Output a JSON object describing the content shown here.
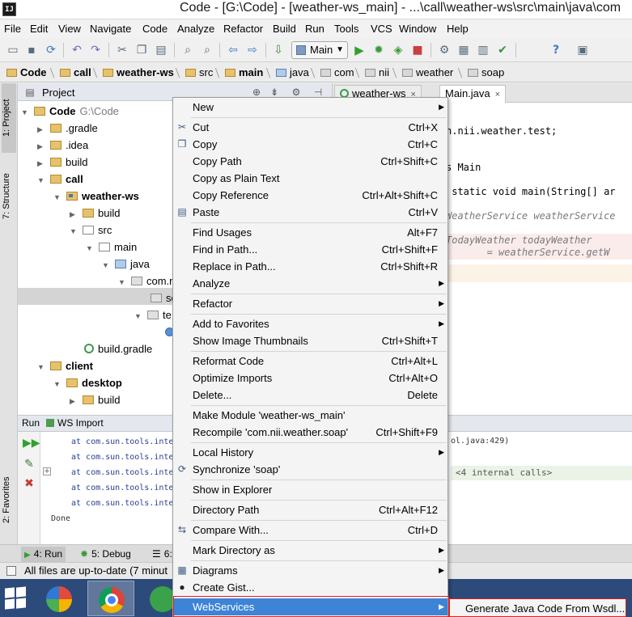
{
  "window": {
    "app_icon": "IJ",
    "title": "Code - [G:\\Code] - [weather-ws_main] - ...\\call\\weather-ws\\src\\main\\java\\com"
  },
  "menubar": {
    "items": [
      "File",
      "Edit",
      "View",
      "Navigate",
      "Code",
      "Analyze",
      "Refactor",
      "Build",
      "Run",
      "Tools",
      "VCS",
      "Window",
      "Help"
    ]
  },
  "toolbar": {
    "run_config": "Main",
    "icons": [
      "save-icon",
      "sync-icon",
      "undo-icon",
      "redo-icon",
      "cut-icon",
      "copy-icon",
      "paste-icon",
      "find-icon",
      "replace-icon",
      "back-icon",
      "forward-icon",
      "build-icon",
      "run-icon",
      "debug-icon",
      "coverage-icon",
      "stop-icon",
      "settings-icon",
      "project-structure-icon",
      "help-icon",
      "terminal-icon"
    ]
  },
  "breadcrumbs": [
    "Code",
    "call",
    "weather-ws",
    "src",
    "main",
    "java",
    "com",
    "nii",
    "weather",
    "soap"
  ],
  "left_strip": {
    "project": "1: Project",
    "structure": "7: Structure",
    "favorites": "2: Favorites"
  },
  "project_panel": {
    "title": "Project",
    "tree": [
      {
        "label": "Code",
        "note": "G:\\Code",
        "bold": true
      },
      {
        "label": ".gradle"
      },
      {
        "label": ".idea"
      },
      {
        "label": "build"
      },
      {
        "label": "call",
        "bold": true
      },
      {
        "label": "weather-ws",
        "bold": true
      },
      {
        "label": "build"
      },
      {
        "label": "src"
      },
      {
        "label": "main"
      },
      {
        "label": "java"
      },
      {
        "label": "com.n"
      },
      {
        "label": "so"
      },
      {
        "label": "te"
      },
      {
        "label": ""
      },
      {
        "label": "build.gradle"
      },
      {
        "label": "client",
        "bold": true
      },
      {
        "label": "desktop",
        "bold": true
      },
      {
        "label": "build"
      }
    ]
  },
  "editor": {
    "tabs": [
      {
        "label": "weather-ws",
        "close": "×"
      },
      {
        "label": "Main.java",
        "close": "×"
      }
    ],
    "lines": [
      "n.nii.weather.test;",
      "",
      "s Main",
      "",
      " static void main(String[] ar",
      "",
      "WeatherService weatherService",
      "",
      "TodayWeather todayWeather",
      "       = weatherService.getW"
    ]
  },
  "run_panel": {
    "title": "Run",
    "tab": "WS Import",
    "log": [
      "at com.sun.tools.inte",
      "at com.sun.tools.inte",
      "at com.sun.tools.inte",
      "at com.sun.tools.inte",
      "at com.sun.tools.inte",
      "Done"
    ],
    "link_text": "ol.java:429)",
    "internal_calls": "<4 internal calls>"
  },
  "bottom_tabs": [
    "4: Run",
    "5: Debug",
    "6:"
  ],
  "status": {
    "text": "All files are up-to-date (7 minut"
  },
  "context_menu": {
    "items": [
      {
        "label": "New",
        "submenu": "▶"
      },
      {
        "sep": true
      },
      {
        "label": "Cut",
        "shortcut": "Ctrl+X",
        "icon": "✂"
      },
      {
        "label": "Copy",
        "shortcut": "Ctrl+C",
        "icon": "❐"
      },
      {
        "label": "Copy Path",
        "shortcut": "Ctrl+Shift+C"
      },
      {
        "label": "Copy as Plain Text"
      },
      {
        "label": "Copy Reference",
        "shortcut": "Ctrl+Alt+Shift+C"
      },
      {
        "label": "Paste",
        "shortcut": "Ctrl+V",
        "icon": "▤"
      },
      {
        "sep": true
      },
      {
        "label": "Find Usages",
        "shortcut": "Alt+F7"
      },
      {
        "label": "Find in Path...",
        "shortcut": "Ctrl+Shift+F"
      },
      {
        "label": "Replace in Path...",
        "shortcut": "Ctrl+Shift+R"
      },
      {
        "label": "Analyze",
        "submenu": "▶"
      },
      {
        "sep": true
      },
      {
        "label": "Refactor",
        "submenu": "▶"
      },
      {
        "sep": true
      },
      {
        "label": "Add to Favorites",
        "submenu": "▶"
      },
      {
        "label": "Show Image Thumbnails",
        "shortcut": "Ctrl+Shift+T"
      },
      {
        "sep": true
      },
      {
        "label": "Reformat Code",
        "shortcut": "Ctrl+Alt+L"
      },
      {
        "label": "Optimize Imports",
        "shortcut": "Ctrl+Alt+O"
      },
      {
        "label": "Delete...",
        "shortcut": "Delete"
      },
      {
        "sep": true
      },
      {
        "label": "Make Module 'weather-ws_main'"
      },
      {
        "label": "Recompile 'com.nii.weather.soap'",
        "shortcut": "Ctrl+Shift+F9"
      },
      {
        "sep": true
      },
      {
        "label": "Local History",
        "submenu": "▶"
      },
      {
        "label": "Synchronize 'soap'",
        "icon": "⟳"
      },
      {
        "sep": true
      },
      {
        "label": "Show in Explorer"
      },
      {
        "sep": true
      },
      {
        "label": "Directory Path",
        "shortcut": "Ctrl+Alt+F12"
      },
      {
        "sep": true
      },
      {
        "label": "Compare With...",
        "shortcut": "Ctrl+D",
        "icon": "⇆"
      },
      {
        "sep": true
      },
      {
        "label": "Mark Directory as",
        "submenu": "▶"
      },
      {
        "sep": true
      },
      {
        "label": "Diagrams",
        "submenu": "▶",
        "icon": "▦"
      },
      {
        "label": "Create Gist...",
        "icon": "●"
      },
      {
        "label": "WebServices",
        "submenu": "▶",
        "highlighted": true
      }
    ]
  },
  "submenu": {
    "item": "Generate Java Code From Wsdl..."
  },
  "colors": {
    "menu_highlight": "#3d84d6",
    "taskbar": "#2c4a7a",
    "outline_red": "#e02020"
  }
}
